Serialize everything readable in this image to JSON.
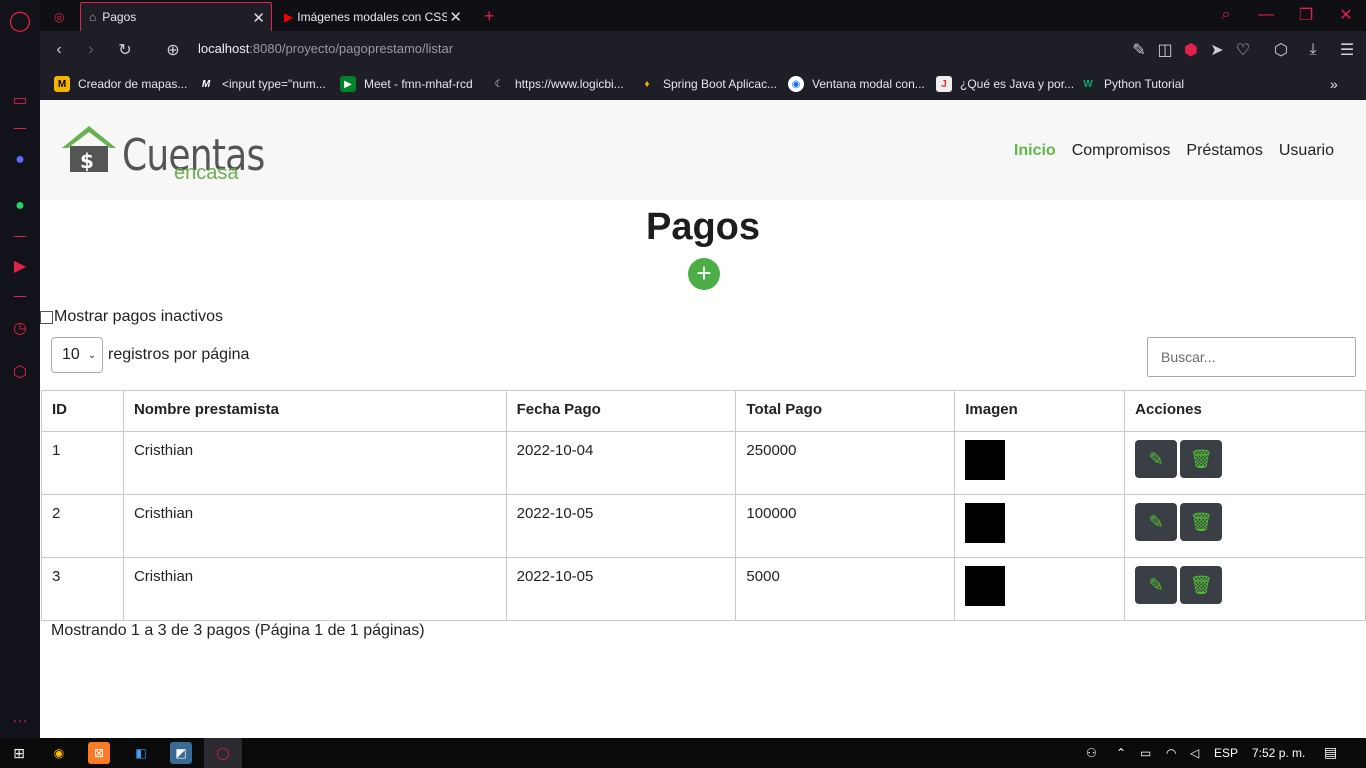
{
  "browser": {
    "tabs": [
      {
        "label": "Pagos",
        "active": true
      },
      {
        "label": "Imágenes modales con CSS",
        "active": false
      }
    ],
    "url_host": "localhost",
    "url_rest": ":8080/proyecto/pagoprestamo/listar",
    "bookmarks": [
      {
        "label": "Creador de mapas..."
      },
      {
        "label": "<input type=\"num..."
      },
      {
        "label": "Meet - fmn-mhaf-rcd"
      },
      {
        "label": "https://www.logicbi..."
      },
      {
        "label": "Spring Boot Aplicac..."
      },
      {
        "label": "Ventana modal con..."
      },
      {
        "label": "¿Qué es Java y por..."
      },
      {
        "label": "Python Tutorial"
      }
    ]
  },
  "site": {
    "logo_main": "Cuentas",
    "logo_sub": "encasa",
    "nav": [
      "Inicio",
      "Compromisos",
      "Préstamos",
      "Usuario"
    ]
  },
  "main": {
    "title": "Pagos",
    "add_symbol": "+",
    "inactive_label": "Mostrar pagos inactivos",
    "per_page_value": "10",
    "per_page_label": "registros por página",
    "search_placeholder": "Buscar...",
    "columns": [
      "ID",
      "Nombre prestamista",
      "Fecha Pago",
      "Total Pago",
      "Imagen",
      "Acciones"
    ],
    "rows": [
      {
        "id": "1",
        "name": "Cristhian",
        "date": "2022-10-04",
        "total": "250000"
      },
      {
        "id": "2",
        "name": "Cristhian",
        "date": "2022-10-05",
        "total": "100000"
      },
      {
        "id": "3",
        "name": "Cristhian",
        "date": "2022-10-05",
        "total": "5000"
      }
    ],
    "summary": "Mostrando 1 a 3 de 3 pagos (Página 1 de 1 páginas)"
  },
  "taskbar": {
    "lang": "ESP",
    "time": "7:52 p. m."
  },
  "colors": {
    "accent_green": "#4cae46",
    "opera_red": "#e0214a"
  }
}
